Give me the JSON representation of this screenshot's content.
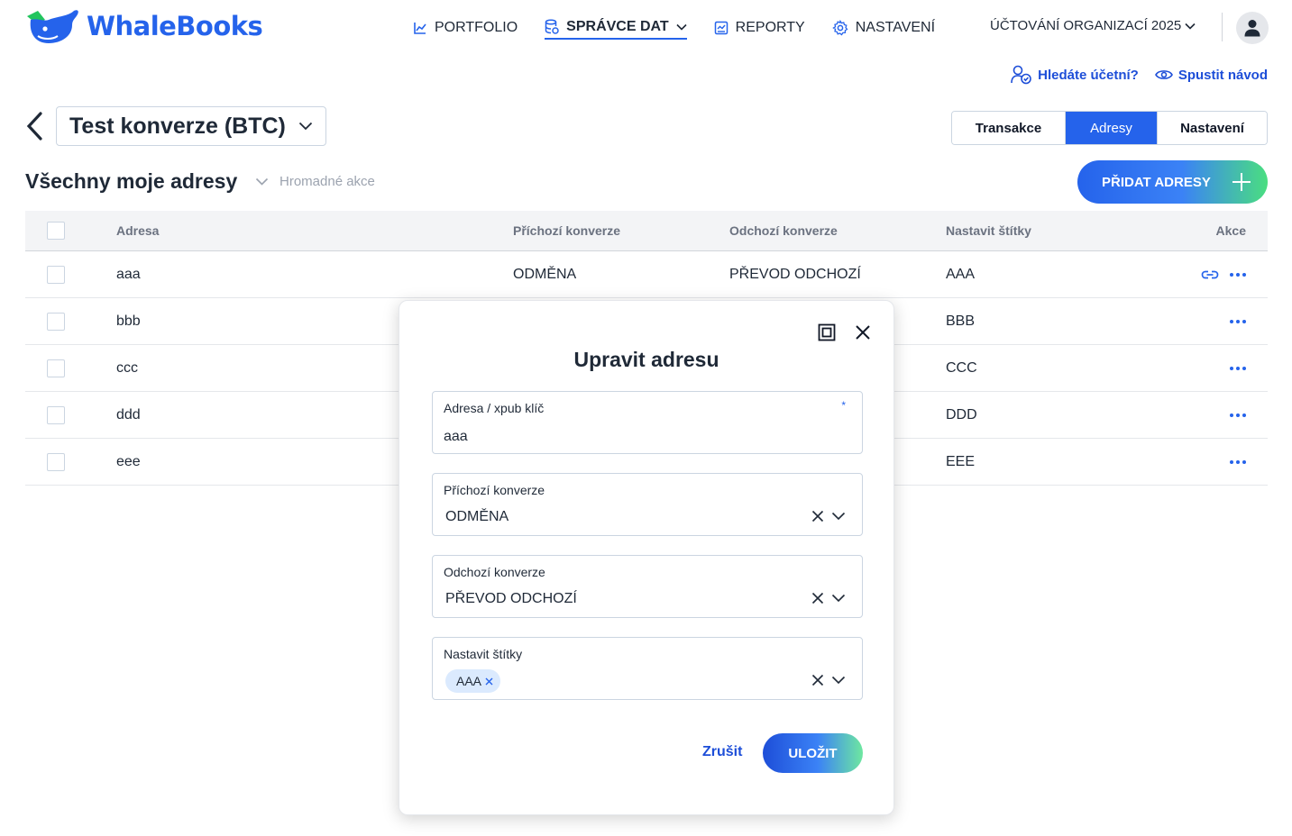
{
  "app": {
    "name": "WhaleBooks"
  },
  "nav": [
    {
      "label": "PORTFOLIO",
      "icon": "chart-line-icon",
      "active": false
    },
    {
      "label": "SPRÁVCE DAT",
      "icon": "database-icon",
      "active": true
    },
    {
      "label": "REPORTY",
      "icon": "report-icon",
      "active": false
    },
    {
      "label": "NASTAVENÍ",
      "icon": "gear-icon",
      "active": false
    }
  ],
  "org": {
    "label": "ÚČTOVÁNÍ ORGANIZACÍ 2025"
  },
  "help": {
    "accountant": "Hledáte účetní?",
    "tour": "Spustit návod"
  },
  "wallet": {
    "name": "Test konverze (BTC)"
  },
  "tabs": [
    {
      "label": "Transakce",
      "active": false
    },
    {
      "label": "Adresy",
      "active": true
    },
    {
      "label": "Nastavení",
      "active": false
    }
  ],
  "section": {
    "title": "Všechny moje adresy",
    "bulk": "Hromadné akce",
    "add_button": "PŘIDAT ADRESY"
  },
  "table": {
    "headers": {
      "address": "Adresa",
      "incoming": "Příchozí konverze",
      "outgoing": "Odchozí konverze",
      "tags": "Nastavit štítky",
      "actions": "Akce"
    },
    "rows": [
      {
        "address": "aaa",
        "incoming": "ODMĚNA",
        "outgoing": "PŘEVOD ODCHOZÍ",
        "tag": "AAA"
      },
      {
        "address": "bbb",
        "incoming": "",
        "outgoing": "",
        "tag": "BBB"
      },
      {
        "address": "ccc",
        "incoming": "",
        "outgoing": "",
        "tag": "CCC"
      },
      {
        "address": "ddd",
        "incoming": "",
        "outgoing": "",
        "tag": "DDD"
      },
      {
        "address": "eee",
        "incoming": "",
        "outgoing": "",
        "tag": "EEE"
      }
    ]
  },
  "modal": {
    "title": "Upravit adresu",
    "address_label": "Adresa / xpub klíč",
    "required_mark": "*",
    "address_value": "aaa",
    "incoming_label": "Příchozí konverze",
    "incoming_value": "ODMĚNA",
    "outgoing_label": "Odchozí konverze",
    "outgoing_value": "PŘEVOD ODCHOZÍ",
    "tags_label": "Nastavit štítky",
    "tags": [
      "AAA"
    ],
    "cancel": "Zrušit",
    "save": "ULOŽIT"
  },
  "colors": {
    "accent": "#2563eb",
    "gradient_end": "#4ade80"
  }
}
